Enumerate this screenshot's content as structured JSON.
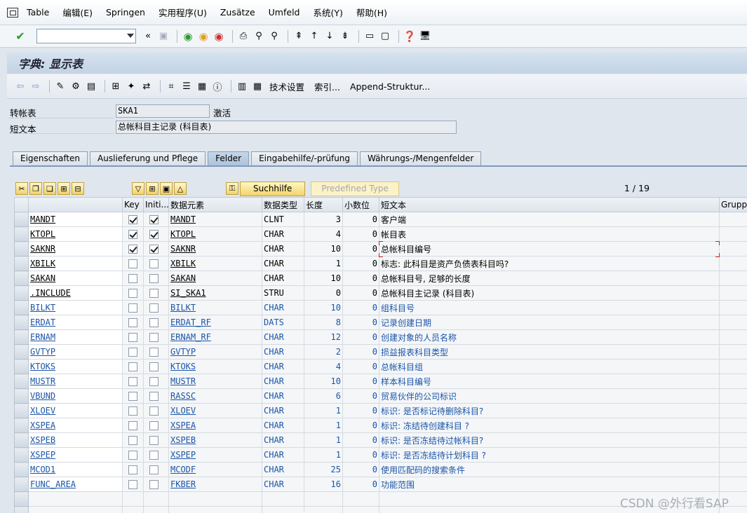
{
  "menu": [
    "Table",
    "编辑(E)",
    "Springen",
    "实用程序(U)",
    "Zusätze",
    "Umfeld",
    "系统(Y)",
    "帮助(H)"
  ],
  "title": "字典: 显示表",
  "app_toolbar": {
    "tech_settings": "技术设置",
    "indexes": "索引...",
    "append": "Append-Struktur..."
  },
  "header": {
    "table_label": "转帐表",
    "table_value": "SKA1",
    "status": "激活",
    "short_label": "短文本",
    "short_value": "总帐科目主记录 (科目表)"
  },
  "tabs": [
    "Eigenschaften",
    "Auslieferung und Pflege",
    "Felder",
    "Eingabehilfe/-prüfung",
    "Währungs-/Mengenfelder"
  ],
  "active_tab": "Felder",
  "buttons": {
    "search_help": "Suchhilfe",
    "predefined_type": "Predefined Type"
  },
  "pager": "1  /  19",
  "columns": [
    "",
    "",
    "Key",
    "Initi...",
    "数据元素",
    "数据类型",
    "长度",
    "小数位",
    "短文本",
    "Gruppe"
  ],
  "rows": [
    {
      "field": "MANDT",
      "key": true,
      "init": true,
      "elem": "MANDT",
      "type": "CLNT",
      "len": "3",
      "dec": "0",
      "text": "客户端",
      "blue": false
    },
    {
      "field": "KTOPL",
      "key": true,
      "init": true,
      "elem": "KTOPL",
      "type": "CHAR",
      "len": "4",
      "dec": "0",
      "text": "帐目表",
      "blue": false
    },
    {
      "field": "SAKNR",
      "key": true,
      "init": true,
      "elem": "SAKNR",
      "type": "CHAR",
      "len": "10",
      "dec": "0",
      "text": "总帐科目编号",
      "blue": false
    },
    {
      "field": "XBILK",
      "key": false,
      "init": false,
      "elem": "XBILK",
      "type": "CHAR",
      "len": "1",
      "dec": "0",
      "text": "标志: 此科目是资产负债表科目吗?",
      "blue": false
    },
    {
      "field": "SAKAN",
      "key": false,
      "init": false,
      "elem": "SAKAN",
      "type": "CHAR",
      "len": "10",
      "dec": "0",
      "text": "总帐科目号, 足够的长度",
      "blue": false
    },
    {
      "field": ".INCLUDE",
      "key": false,
      "init": false,
      "elem": "SI_SKA1",
      "type": "STRU",
      "len": "0",
      "dec": "0",
      "text": "总帐科目主记录 (科目表)",
      "blue": false
    },
    {
      "field": "BILKT",
      "key": false,
      "init": false,
      "elem": "BILKT",
      "type": "CHAR",
      "len": "10",
      "dec": "0",
      "text": "组科目号",
      "blue": true
    },
    {
      "field": "ERDAT",
      "key": false,
      "init": false,
      "elem": "ERDAT_RF",
      "type": "DATS",
      "len": "8",
      "dec": "0",
      "text": "记录创建日期",
      "blue": true
    },
    {
      "field": "ERNAM",
      "key": false,
      "init": false,
      "elem": "ERNAM_RF",
      "type": "CHAR",
      "len": "12",
      "dec": "0",
      "text": "创建对象的人员名称",
      "blue": true
    },
    {
      "field": "GVTYP",
      "key": false,
      "init": false,
      "elem": "GVTYP",
      "type": "CHAR",
      "len": "2",
      "dec": "0",
      "text": "损益报表科目类型",
      "blue": true
    },
    {
      "field": "KTOKS",
      "key": false,
      "init": false,
      "elem": "KTOKS",
      "type": "CHAR",
      "len": "4",
      "dec": "0",
      "text": "总帐科目组",
      "blue": true
    },
    {
      "field": "MUSTR",
      "key": false,
      "init": false,
      "elem": "MUSTR",
      "type": "CHAR",
      "len": "10",
      "dec": "0",
      "text": "样本科目编号",
      "blue": true
    },
    {
      "field": "VBUND",
      "key": false,
      "init": false,
      "elem": "RASSC",
      "type": "CHAR",
      "len": "6",
      "dec": "0",
      "text": "贸易伙伴的公司标识",
      "blue": true
    },
    {
      "field": "XLOEV",
      "key": false,
      "init": false,
      "elem": "XLOEV",
      "type": "CHAR",
      "len": "1",
      "dec": "0",
      "text": "标识: 是否标记待删除科目?",
      "blue": true
    },
    {
      "field": "XSPEA",
      "key": false,
      "init": false,
      "elem": "XSPEA",
      "type": "CHAR",
      "len": "1",
      "dec": "0",
      "text": "标识: 冻结待创建科目 ?",
      "blue": true
    },
    {
      "field": "XSPEB",
      "key": false,
      "init": false,
      "elem": "XSPEB",
      "type": "CHAR",
      "len": "1",
      "dec": "0",
      "text": "标识: 是否冻结待过帐科目?",
      "blue": true
    },
    {
      "field": "XSPEP",
      "key": false,
      "init": false,
      "elem": "XSPEP",
      "type": "CHAR",
      "len": "1",
      "dec": "0",
      "text": "标识: 是否冻结待计划科目 ?",
      "blue": true
    },
    {
      "field": "MCOD1",
      "key": false,
      "init": false,
      "elem": "MCODF",
      "type": "CHAR",
      "len": "25",
      "dec": "0",
      "text": "使用匹配码的搜索条件",
      "blue": true
    },
    {
      "field": "FUNC_AREA",
      "key": false,
      "init": false,
      "elem": "FKBER",
      "type": "CHAR",
      "len": "16",
      "dec": "0",
      "text": "功能范围",
      "blue": true
    }
  ],
  "watermark": "CSDN @外行看SAP"
}
